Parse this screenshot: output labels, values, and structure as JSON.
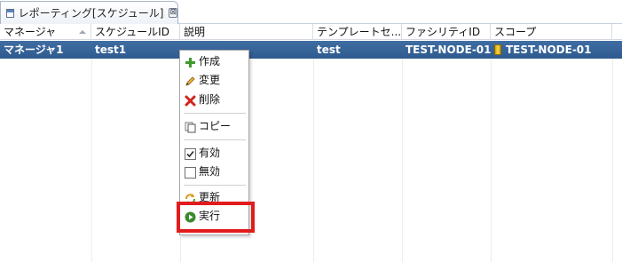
{
  "view_tab": {
    "title": "レポーティング[スケジュール]",
    "close_glyph": "⊠"
  },
  "table": {
    "columns": [
      {
        "label": "マネージャ",
        "sorted": true
      },
      {
        "label": "スケジュールID",
        "sorted": false
      },
      {
        "label": "説明",
        "sorted": false
      },
      {
        "label": "テンプレートセ...",
        "sorted": false
      },
      {
        "label": "ファシリティID",
        "sorted": false
      },
      {
        "label": "スコープ",
        "sorted": false
      }
    ],
    "rows": [
      {
        "manager": "マネージャ1",
        "schedule_id": "test1",
        "description": "",
        "template_set": "test",
        "facility_id": "TEST-NODE-01",
        "scope": "TEST-NODE-01",
        "selected": true
      }
    ]
  },
  "context_menu": {
    "items": {
      "create": "作成",
      "modify": "変更",
      "delete": "削除",
      "copy": "コピー",
      "enable": "有効",
      "disable": "無効",
      "refresh": "更新",
      "execute": "実行"
    },
    "enable_checked": true,
    "disable_checked": false,
    "highlighted_item": "実行",
    "highlight_color": "#e21c1c"
  },
  "colors": {
    "selection": "#3a679c",
    "accent": "#e21c1c"
  }
}
